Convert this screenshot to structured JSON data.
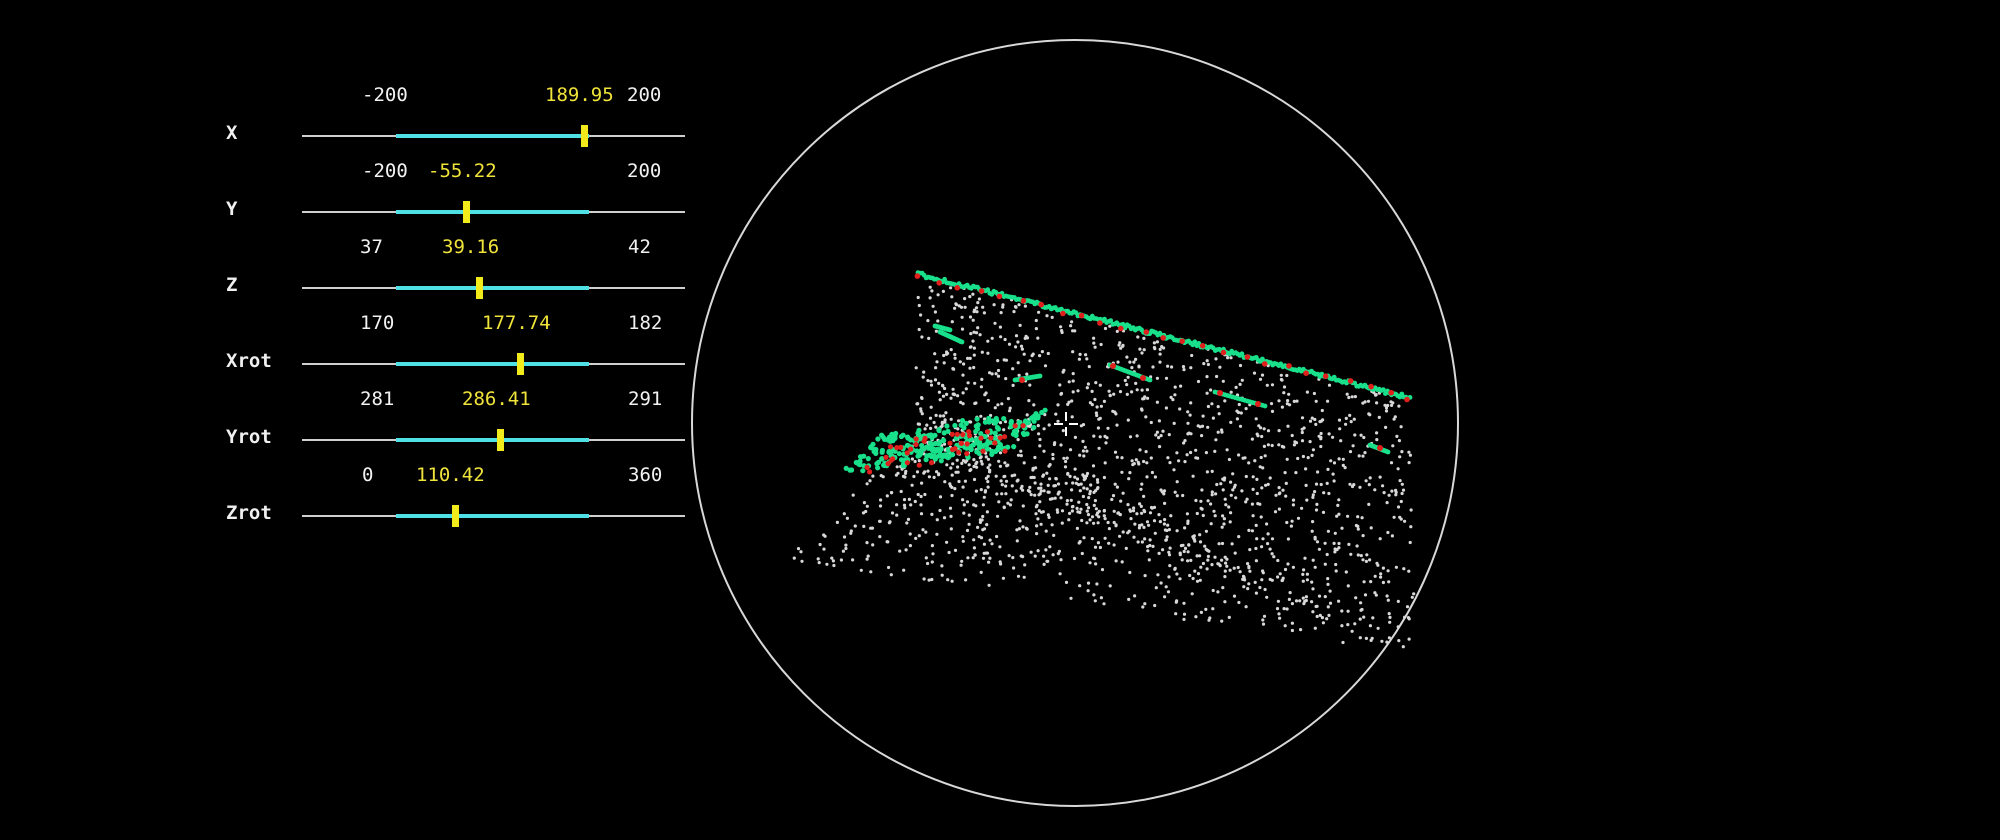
{
  "sliders": [
    {
      "label": "X",
      "min_label": "-200",
      "max_label": "200",
      "current": "189.95",
      "min": -200,
      "max": 200,
      "value": 189.95
    },
    {
      "label": "Y",
      "min_label": "-200",
      "max_label": "200",
      "current": "-55.22",
      "min": -200,
      "max": 200,
      "value": -55.22
    },
    {
      "label": "Z",
      "min_label": "37",
      "max_label": "42",
      "current": "39.16",
      "min": 37,
      "max": 42,
      "value": 39.16
    },
    {
      "label": "Xrot",
      "min_label": "170",
      "max_label": "182",
      "current": "177.74",
      "min": 170,
      "max": 182,
      "value": 177.74
    },
    {
      "label": "Yrot",
      "min_label": "281",
      "max_label": "291",
      "current": "286.41",
      "min": 281,
      "max": 291,
      "value": 286.41
    },
    {
      "label": "Zrot",
      "min_label": "0",
      "max_label": "360",
      "current": "110.42",
      "min": 0,
      "max": 360,
      "value": 110.42
    }
  ],
  "colors": {
    "background": "#000000",
    "track": "#cfcfcf",
    "track_active": "#4fe0e6",
    "thumb": "#f3ea1c",
    "value_text": "#f0e33a",
    "points": "#d8d8d8",
    "edge_points": "#19e08a",
    "marker_points": "#e0201c",
    "circle": "#d8d8d8"
  },
  "icons": {
    "cursor": "crosshair-cursor-icon"
  }
}
